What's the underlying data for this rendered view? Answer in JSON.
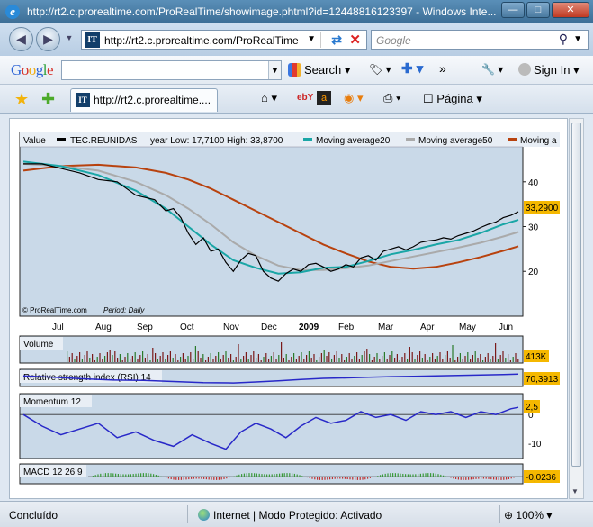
{
  "window": {
    "title": "http://rt2.c.prorealtime.com/ProRealTime/showimage.phtml?id=12448816123397 - Windows Inte...",
    "minimize": "—",
    "maximize": "□",
    "close": "✕"
  },
  "address": {
    "url": "http://rt2.c.prorealtime.com/ProRealTime",
    "site_icon": "IT",
    "search_placeholder": "Google"
  },
  "google_toolbar": {
    "logo": [
      "G",
      "o",
      "o",
      "g",
      "l",
      "e"
    ],
    "logo_colors": [
      "#2c63d6",
      "#d8322b",
      "#f0ae18",
      "#2c63d6",
      "#2ea13c",
      "#d8322b"
    ],
    "search_label": "Search",
    "more": "»",
    "sign_in": "Sign In"
  },
  "tabs": {
    "active_tab": "http://rt2.c.prorealtime....",
    "page_menu": "Página"
  },
  "chart_data": {
    "type": "line",
    "symbol": "TEC.REUNIDAS",
    "header": {
      "value_label": "Value",
      "symbol_label": "TEC.REUNIDAS",
      "year_range": "year Low: 17,7100 High: 33,8700",
      "ma20": "Moving average20",
      "ma50": "Moving average50",
      "ma200": "Moving a"
    },
    "colors": {
      "price": "#000000",
      "ma20": "#1aa6a6",
      "ma50": "#aaaaaa",
      "ma200": "#b8420e",
      "rsi": "#2828c8",
      "momentum": "#2828c8",
      "badge": "#f5b800"
    },
    "x_labels": [
      "Jul",
      "Aug",
      "Sep",
      "Oct",
      "Nov",
      "Dec",
      "2009",
      "Feb",
      "Mar",
      "Apr",
      "May",
      "Jun"
    ],
    "y_ticks": [
      "40",
      "30",
      "20"
    ],
    "ylim": [
      12,
      47
    ],
    "last_price": "33,2900",
    "copyright": "© ProRealTime.com",
    "period": "Period: Daily",
    "price_points": [
      [
        0,
        44.0
      ],
      [
        5,
        44.0
      ],
      [
        10,
        43.0
      ],
      [
        15,
        42.0
      ],
      [
        20,
        40.5
      ],
      [
        25,
        40.0
      ],
      [
        30,
        37.0
      ],
      [
        35,
        36.0
      ],
      [
        38,
        33.5
      ],
      [
        40,
        34.0
      ],
      [
        42,
        32.0
      ],
      [
        44,
        28.5
      ],
      [
        46,
        26.0
      ],
      [
        48,
        27.5
      ],
      [
        50,
        24.5
      ],
      [
        52,
        25.0
      ],
      [
        54,
        22.0
      ],
      [
        56,
        20.0
      ],
      [
        58,
        22.5
      ],
      [
        60,
        24.0
      ],
      [
        62,
        23.5
      ],
      [
        64,
        20.0
      ],
      [
        66,
        18.5
      ],
      [
        68,
        17.8
      ],
      [
        70,
        19.5
      ],
      [
        72,
        20.5
      ],
      [
        74,
        20.0
      ],
      [
        76,
        21.5
      ],
      [
        78,
        21.8
      ],
      [
        80,
        21.0
      ],
      [
        82,
        20.0
      ],
      [
        84,
        20.5
      ],
      [
        86,
        21.5
      ],
      [
        88,
        21.0
      ],
      [
        90,
        23.0
      ],
      [
        92,
        23.5
      ],
      [
        94,
        22.5
      ],
      [
        96,
        24.5
      ],
      [
        98,
        25.0
      ],
      [
        100,
        25.5
      ],
      [
        102,
        24.8
      ],
      [
        104,
        25.5
      ],
      [
        106,
        26.5
      ],
      [
        108,
        26.8
      ],
      [
        110,
        27.0
      ],
      [
        112,
        27.5
      ],
      [
        114,
        27.2
      ],
      [
        116,
        28.0
      ],
      [
        118,
        28.5
      ],
      [
        120,
        29.0
      ],
      [
        122,
        29.8
      ],
      [
        124,
        30.5
      ],
      [
        126,
        31.0
      ],
      [
        128,
        32.0
      ],
      [
        130,
        32.5
      ],
      [
        132,
        33.3
      ]
    ],
    "ma20_points": [
      [
        0,
        44.5
      ],
      [
        10,
        43.5
      ],
      [
        20,
        41.5
      ],
      [
        30,
        38.0
      ],
      [
        38,
        34.0
      ],
      [
        44,
        30.0
      ],
      [
        50,
        26.0
      ],
      [
        56,
        22.5
      ],
      [
        62,
        20.8
      ],
      [
        68,
        19.5
      ],
      [
        74,
        19.8
      ],
      [
        80,
        20.8
      ],
      [
        86,
        21.0
      ],
      [
        92,
        22.3
      ],
      [
        98,
        23.8
      ],
      [
        104,
        24.8
      ],
      [
        110,
        26.0
      ],
      [
        116,
        27.0
      ],
      [
        122,
        28.6
      ],
      [
        128,
        30.5
      ],
      [
        132,
        31.5
      ]
    ],
    "ma50_points": [
      [
        0,
        44.0
      ],
      [
        10,
        43.5
      ],
      [
        20,
        42.5
      ],
      [
        30,
        40.0
      ],
      [
        38,
        37.0
      ],
      [
        44,
        34.0
      ],
      [
        50,
        30.5
      ],
      [
        56,
        26.5
      ],
      [
        62,
        23.5
      ],
      [
        68,
        21.3
      ],
      [
        74,
        20.3
      ],
      [
        80,
        20.3
      ],
      [
        86,
        20.7
      ],
      [
        92,
        21.3
      ],
      [
        98,
        22.3
      ],
      [
        104,
        23.3
      ],
      [
        110,
        24.3
      ],
      [
        116,
        25.3
      ],
      [
        122,
        26.4
      ],
      [
        128,
        27.8
      ],
      [
        132,
        28.8
      ]
    ],
    "ma200_points": [
      [
        0,
        42.5
      ],
      [
        10,
        43.5
      ],
      [
        20,
        43.8
      ],
      [
        30,
        43.2
      ],
      [
        38,
        42.0
      ],
      [
        44,
        40.5
      ],
      [
        50,
        38.5
      ],
      [
        56,
        36.0
      ],
      [
        62,
        33.5
      ],
      [
        68,
        31.0
      ],
      [
        74,
        28.5
      ],
      [
        80,
        26.0
      ],
      [
        86,
        24.0
      ],
      [
        92,
        22.2
      ],
      [
        98,
        21.0
      ],
      [
        104,
        20.6
      ],
      [
        110,
        21.0
      ],
      [
        116,
        22.0
      ],
      [
        122,
        23.2
      ],
      [
        128,
        24.6
      ],
      [
        132,
        25.6
      ]
    ],
    "volume": {
      "label": "Volume",
      "last": "413K"
    },
    "rsi": {
      "label": "Relative strength index (RSI) 14",
      "last": "70,3913",
      "points": [
        [
          0,
          62
        ],
        [
          8,
          55
        ],
        [
          16,
          48
        ],
        [
          24,
          42
        ],
        [
          32,
          40
        ],
        [
          40,
          35
        ],
        [
          48,
          30
        ],
        [
          56,
          28
        ],
        [
          62,
          33
        ],
        [
          68,
          38
        ],
        [
          74,
          45
        ],
        [
          80,
          50
        ],
        [
          86,
          52
        ],
        [
          92,
          55
        ],
        [
          98,
          58
        ],
        [
          104,
          60
        ],
        [
          110,
          62
        ],
        [
          116,
          64
        ],
        [
          122,
          66
        ],
        [
          128,
          68
        ],
        [
          132,
          70
        ]
      ]
    },
    "momentum": {
      "label": "Momentum 12",
      "last": "2,5",
      "y_ticks": [
        "0",
        "-10"
      ],
      "ylim": [
        -14,
        6
      ],
      "points": [
        [
          0,
          0
        ],
        [
          5,
          -4
        ],
        [
          10,
          -7
        ],
        [
          15,
          -5
        ],
        [
          20,
          -3
        ],
        [
          25,
          -8
        ],
        [
          30,
          -6
        ],
        [
          35,
          -9
        ],
        [
          40,
          -11
        ],
        [
          45,
          -7
        ],
        [
          50,
          -10
        ],
        [
          54,
          -12
        ],
        [
          58,
          -6
        ],
        [
          62,
          -3
        ],
        [
          66,
          -5
        ],
        [
          70,
          -8
        ],
        [
          74,
          -4
        ],
        [
          78,
          -1
        ],
        [
          82,
          -3
        ],
        [
          86,
          -2
        ],
        [
          90,
          1
        ],
        [
          94,
          -1
        ],
        [
          98,
          0
        ],
        [
          102,
          -2
        ],
        [
          106,
          1
        ],
        [
          110,
          0
        ],
        [
          114,
          1
        ],
        [
          118,
          -1
        ],
        [
          122,
          1
        ],
        [
          126,
          0
        ],
        [
          130,
          2
        ],
        [
          132,
          2.5
        ]
      ]
    },
    "macd": {
      "label": "MACD 12 26 9",
      "last": "-0,0236"
    }
  },
  "status": {
    "done": "Concluído",
    "zone": "Internet | Modo Protegido: Activado",
    "zoom": "100%"
  }
}
